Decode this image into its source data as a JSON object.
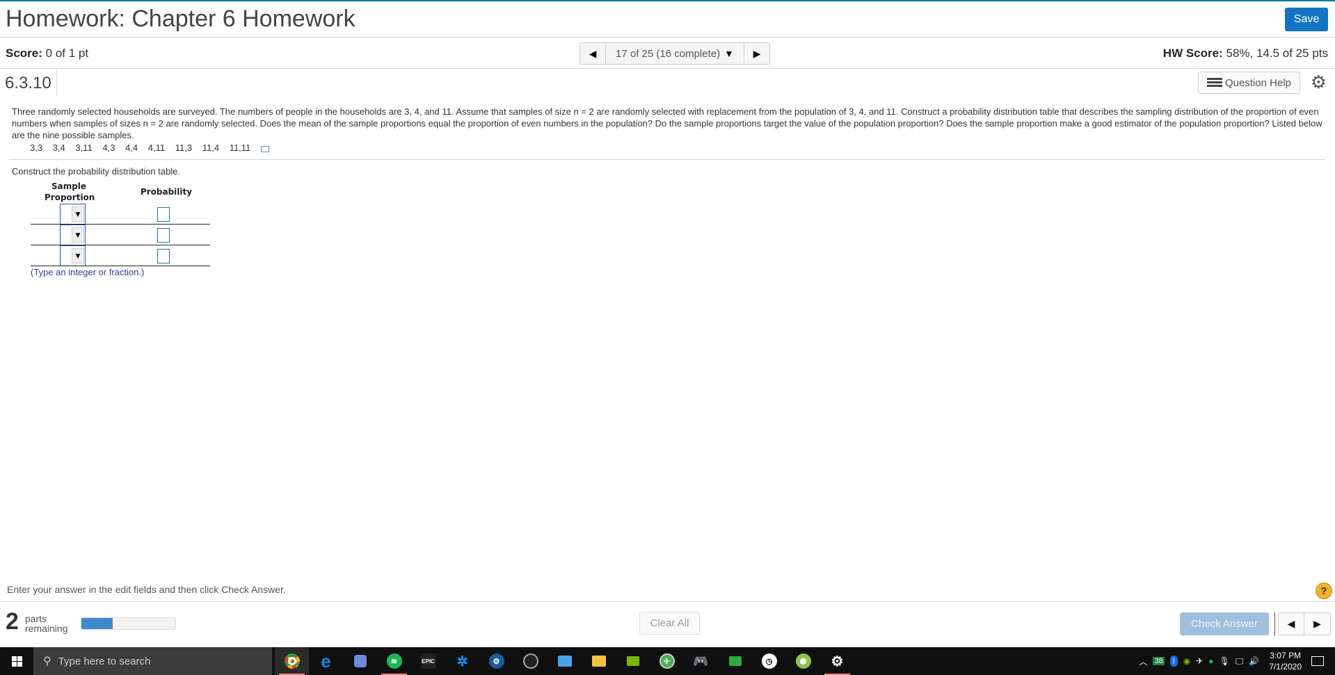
{
  "header": {
    "title": "Homework: Chapter 6 Homework",
    "save_label": "Save"
  },
  "scorebar": {
    "score_label": "Score:",
    "score_value": "0 of 1 pt",
    "nav_position": "17 of 25 (16 complete)",
    "hw_score_label": "HW Score:",
    "hw_score_value": "58%, 14.5 of 25 pts"
  },
  "question_bar": {
    "number": "6.3.10",
    "help_label": "Question Help"
  },
  "question": {
    "text": "Three randomly selected households are surveyed. The numbers of people in the households are 3, 4, and 11. Assume that samples of size n = 2 are randomly selected with replacement from the population of 3, 4, and 11. Construct a probability distribution table that describes the sampling distribution of the proportion of even numbers when samples of sizes n = 2 are randomly selected. Does the mean of the sample proportions equal the proportion of even numbers in the population? Do the sample proportions target the value of the population proportion? Does the sample proportion make a good estimator of the population proportion? Listed below are the nine possible samples.",
    "samples": [
      "3,3",
      "3,4",
      "3,11",
      "4,3",
      "4,4",
      "4,11",
      "11,3",
      "11,4",
      "11,11"
    ]
  },
  "answer": {
    "instruction": "Construct the probability distribution table.",
    "col1": "Sample Proportion",
    "col2": "Probability",
    "rows": [
      {
        "proportion": "",
        "probability": ""
      },
      {
        "proportion": "",
        "probability": ""
      },
      {
        "proportion": "",
        "probability": ""
      }
    ],
    "hint": "(Type an integer or fraction.)"
  },
  "footer": {
    "message": "Enter your answer in the edit fields and then click Check Answer.",
    "parts_count": "2",
    "parts_label_1": "parts",
    "parts_label_2": "remaining",
    "progress_fraction": 0.33,
    "clear_label": "Clear All",
    "check_label": "Check Answer",
    "help_symbol": "?"
  },
  "taskbar": {
    "search_placeholder": "Type here to search",
    "apps": [
      "chrome",
      "edge",
      "discord",
      "spotify",
      "epic-games",
      "battle-net",
      "steam",
      "obs",
      "control-panel",
      "file-explorer",
      "nvidia",
      "xbox",
      "controller",
      "memory",
      "clock",
      "tunnelbear",
      "settings"
    ],
    "tray_badge": "38",
    "time": "3:07 PM",
    "date": "7/1/2020"
  },
  "colors": {
    "accent": "#1474c4",
    "top_stripe": "#0a7ba7",
    "progress": "#3e89cc",
    "check_disabled": "#9fc0dc",
    "hint": "#2f3ca6"
  }
}
